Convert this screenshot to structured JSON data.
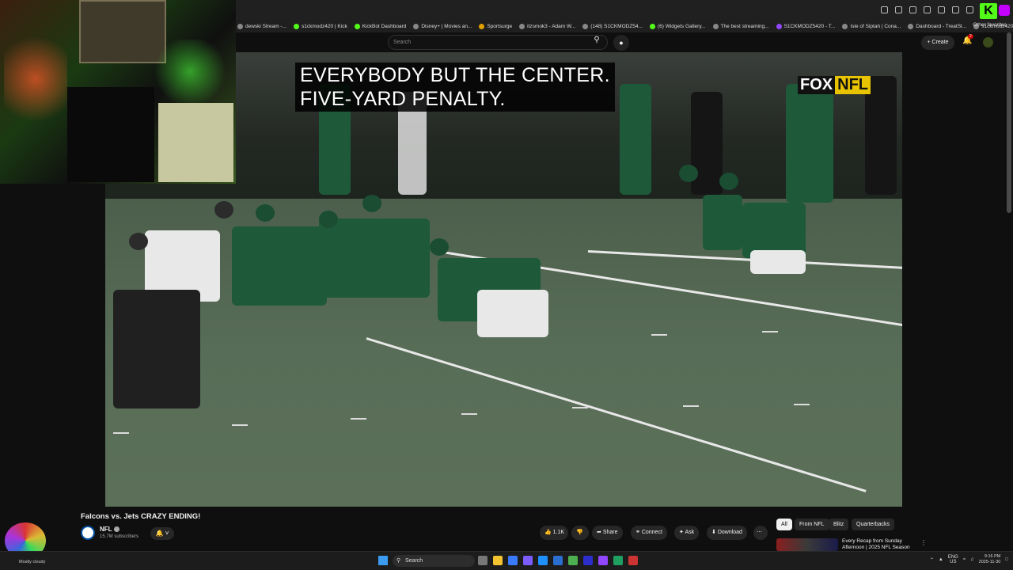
{
  "bookmarks": [
    {
      "label": "dewski Stream -...",
      "color": "#888888"
    },
    {
      "label": "s1ckmodz420 | Kick",
      "color": "#53fc18"
    },
    {
      "label": "KickBot Dashboard",
      "color": "#53fc18"
    },
    {
      "label": "Disney+ | Movies an...",
      "color": "#888888"
    },
    {
      "label": "Sportsurge",
      "color": "#e0a000"
    },
    {
      "label": "itzsmok3 - Adam W...",
      "color": "#888888"
    },
    {
      "label": "(148) S1CKMODZ54...",
      "color": "#888888"
    },
    {
      "label": "(6) Widgets Gallery...",
      "color": "#53fc18"
    },
    {
      "label": "The best streaming...",
      "color": "#888888"
    },
    {
      "label": "S1CKMODZ5420 - T...",
      "color": "#9146ff"
    },
    {
      "label": "Isle of Siptah | Cona...",
      "color": "#888888"
    },
    {
      "label": "Dashboard - TreatSt...",
      "color": "#888888"
    },
    {
      "label": "s1ckmodz420 - Kic...",
      "color": "#888888"
    }
  ],
  "bookmarks_other": "Other favorites",
  "header": {
    "search_placeholder": "Search",
    "create_label": "Create",
    "notification_count": "2"
  },
  "video": {
    "caption_line1": "EVERYBODY BUT THE CENTER.",
    "caption_line2": "FIVE-YARD PENALTY.",
    "network_fox": "FOX",
    "network_nfl": "NFL"
  },
  "info": {
    "title": "Falcons vs. Jets CRAZY ENDING!",
    "channel": "NFL",
    "subscribers": "15.7M subscribers",
    "likes": "1.1K",
    "share": "Share",
    "connect": "Connect",
    "ask": "Ask",
    "download": "Download"
  },
  "chips": {
    "all": "All",
    "from": "From NFL",
    "blitz": "Blitz",
    "qbs": "Quarterbacks"
  },
  "recommendation": {
    "title": "Every Recap from Sunday Afternoon | 2025 NFL Season"
  },
  "taskbar": {
    "weather": "Mostly cloudy",
    "search": "Search",
    "lang_top": "ENG",
    "lang_bottom": "US",
    "time": "9:16 PM",
    "date": "2025-11-30"
  }
}
